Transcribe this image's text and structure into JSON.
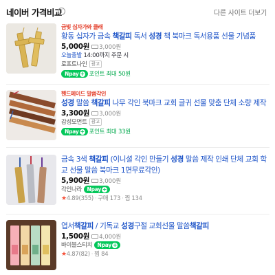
{
  "header": {
    "title": "네이버 가격비교",
    "info_icon": "info-icon",
    "more_link": "다른 사이트 더보기"
  },
  "products": [
    {
      "promo": "금빛 십자가와 클래",
      "title_parts": [
        "황동 십자가 금속 ",
        "책갈피",
        " 독서 ",
        "성경",
        " 책 북마크 독서용품 선물 기념품"
      ],
      "price": "5,000원",
      "shipping": "3,000원",
      "delivery_today": "오늘출발",
      "delivery_rest": " 14:00까지 주문 시",
      "store": "로프트나인",
      "ad_label": "광고",
      "pay_label": "pay",
      "point": "포인트 최대 50원"
    },
    {
      "promo": "핸드메이드 말씀각인",
      "title_parts": [
        "",
        "성경",
        " 말씀 ",
        "책갈피",
        " 나무 각인 북마크 교회 글귀 선물 맞춤 단체 소량 제작"
      ],
      "price": "3,300원",
      "shipping": "3,000원",
      "store": "감성모먼트",
      "ad_label": "광고",
      "pay_label": "pay",
      "point": "포인트 최대 33원"
    },
    {
      "title_parts": [
        "금속 3색 ",
        "책갈피",
        " (이니셜 각인 만들기 ",
        "성경",
        " 말씀 제작 인쇄 단체 교회 학교 선물 말씀 북마크 1면무료각인)"
      ],
      "price": "5,900원",
      "shipping": "3,000원",
      "store": "각인나라",
      "pay_label": "pay",
      "rating": "4.89",
      "reviews": "(355)",
      "purchases": "구매 173",
      "saves": "찜 134"
    },
    {
      "title_parts": [
        "엽서",
        "책갈피",
        " / 기독교 ",
        "성경",
        "구절 교회선물 말씀",
        "책갈피",
        ""
      ],
      "price": "1,500원",
      "shipping": "4,000원",
      "store": "바이블스티치",
      "pay_label": "pay",
      "rating": "4.87",
      "reviews": "(82)",
      "saves": "찜 84"
    }
  ],
  "colors": {
    "link_blue": "#1f55c8",
    "promo_red": "#e4402c",
    "naver_green": "#03c75a",
    "point_green": "#03a94d",
    "star_red": "#f5523a"
  }
}
